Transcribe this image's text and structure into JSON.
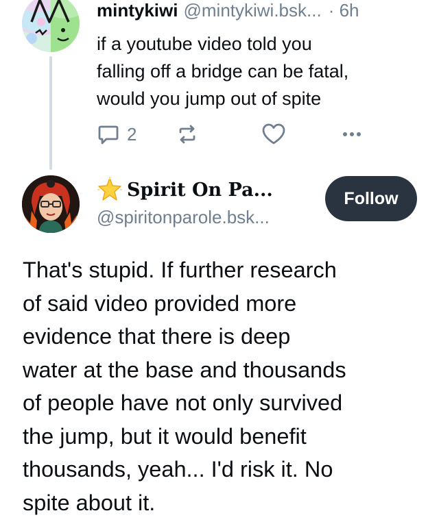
{
  "parent_post": {
    "author_name": "mintykiwi",
    "author_handle": "@mintykiwi.bsk...",
    "time": "· 6h",
    "text": "if a youtube video told you\nfalling off a bridge can be fatal,\nwould you jump out of spite",
    "reply_count": "2",
    "icons": {
      "reply": "reply-icon",
      "repost": "repost-icon",
      "like": "heart-icon",
      "more": "more-icon"
    }
  },
  "reply": {
    "author_name": "Spirit On Pa...",
    "author_handle": "@spiritonparole.bsk...",
    "follow_label": "Follow",
    "text_lines": [
      "That's stupid. If further research",
      "of said video provided more",
      "evidence that there is deep",
      "water at the base and thousands",
      "of people have not only survived",
      "the jump, but it would benefit",
      "thousands, yeah... I'd risk it. No",
      "spite about it."
    ]
  },
  "colors": {
    "text": "#0b0f14",
    "muted": "#6f7f8f",
    "thread_line": "#d4dbe2",
    "follow_button": "#2a3440",
    "follow_text": "#ffffff"
  }
}
